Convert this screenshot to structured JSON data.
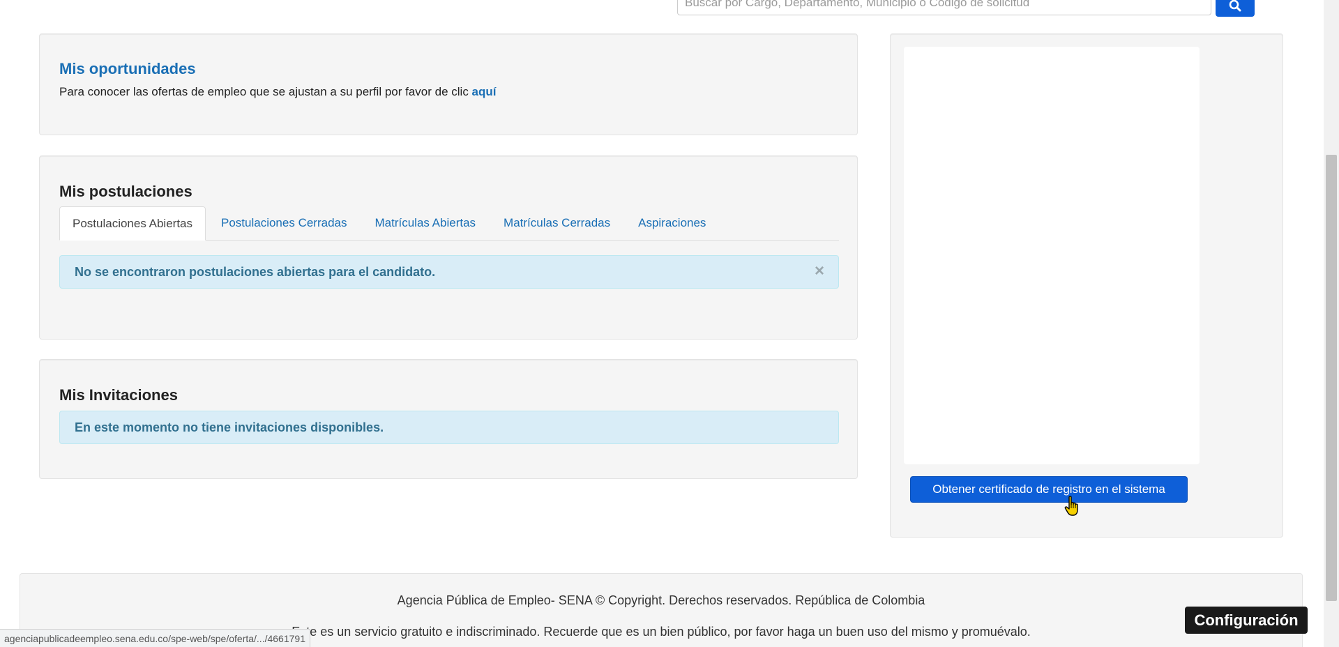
{
  "search": {
    "placeholder": "Buscar por Cargo, Departamento, Municipio o Código de solicitud",
    "button_icon": "search-icon"
  },
  "oportunidades": {
    "title": "Mis oportunidades",
    "text": "Para conocer las ofertas de empleo que se ajustan a su perfil por favor de clic ",
    "link": "aquí"
  },
  "postulaciones": {
    "title": "Mis postulaciones",
    "tabs": [
      {
        "label": "Postulaciones Abiertas",
        "active": true
      },
      {
        "label": "Postulaciones Cerradas",
        "active": false
      },
      {
        "label": "Matrículas Abiertas",
        "active": false
      },
      {
        "label": "Matrículas Cerradas",
        "active": false
      },
      {
        "label": "Aspiraciones",
        "active": false
      }
    ],
    "alert": "No se encontraron postulaciones abiertas para el candidato.",
    "alert_close": "×"
  },
  "invitaciones": {
    "title": "Mis Invitaciones",
    "alert": "En este momento no tiene invitaciones disponibles."
  },
  "right_panel": {
    "cert_button": "Obtener certificado de registro en el sistema"
  },
  "footer": {
    "line1": "Agencia Pública de Empleo- SENA © Copyright. Derechos reservados. República de Colombia",
    "line2": "Este es un servicio gratuito e indiscriminado. Recuerde que es un bien público, por favor haga un buen uso del mismo y promuévalo."
  },
  "status_bar": {
    "url": "agenciapublicadeempleo.sena.edu.co/spe-web/spe/oferta/.../4661791"
  },
  "config_button": "Configuración",
  "colors": {
    "link_blue": "#1a6fb5",
    "button_blue": "#0e5fd8",
    "alert_bg": "#d9edf7",
    "alert_text": "#31708f",
    "panel_bg": "#f5f5f5"
  }
}
